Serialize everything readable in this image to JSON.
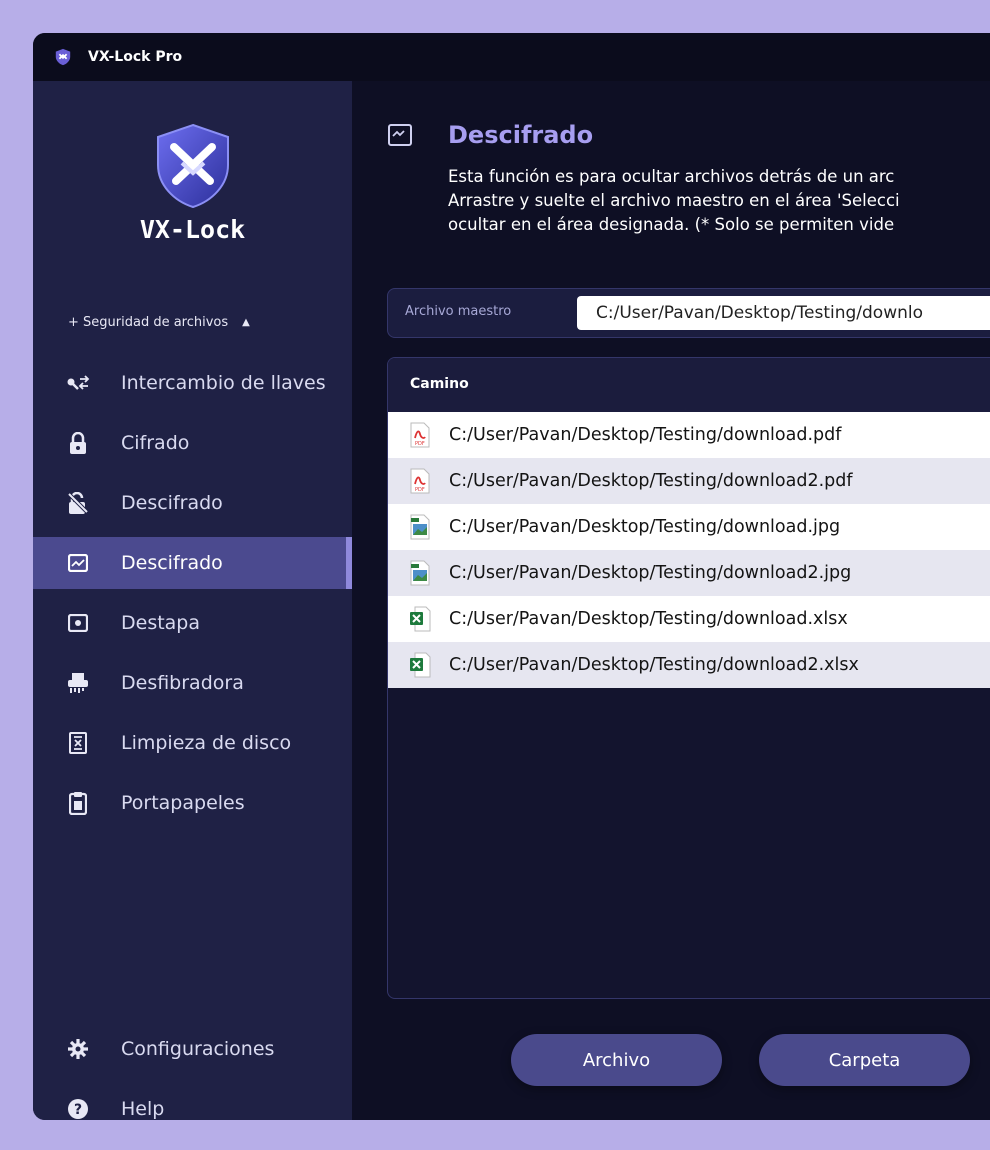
{
  "app": {
    "title": "VX-Lock Pro",
    "logo_text": "VX-Lock"
  },
  "sidebar": {
    "section_label": "+ Seguridad de archivos",
    "items": [
      {
        "label": "Intercambio de llaves",
        "icon": "key-exchange-icon"
      },
      {
        "label": "Cifrado",
        "icon": "lock-icon"
      },
      {
        "label": "Descifrado",
        "icon": "unlock-icon"
      },
      {
        "label": "Descifrado",
        "icon": "image-hide-icon",
        "active": true
      },
      {
        "label": "Destapa",
        "icon": "reveal-icon"
      },
      {
        "label": "Desfibradora",
        "icon": "shredder-icon"
      },
      {
        "label": "Limpieza de disco",
        "icon": "disk-clean-icon"
      },
      {
        "label": "Portapapeles",
        "icon": "clipboard-icon"
      }
    ],
    "bottom": [
      {
        "label": "Configuraciones",
        "icon": "gear-icon"
      },
      {
        "label": "Help",
        "icon": "help-icon"
      }
    ]
  },
  "main": {
    "title": "Descifrado",
    "description": [
      "Esta función es para ocultar archivos detrás de un arc",
      "Arrastre y suelte el archivo maestro en el área 'Selecci",
      "ocultar en el área designada. (* Solo se permiten vide"
    ],
    "master_label": "Archivo maestro",
    "master_value": "C:/User/Pavan/Desktop/Testing/downlo",
    "table_header": "Camino",
    "files": [
      {
        "path": "C:/User/Pavan/Desktop/Testing/download.pdf",
        "type": "pdf"
      },
      {
        "path": "C:/User/Pavan/Desktop/Testing/download2.pdf",
        "type": "pdf"
      },
      {
        "path": "C:/User/Pavan/Desktop/Testing/download.jpg",
        "type": "jpg"
      },
      {
        "path": "C:/User/Pavan/Desktop/Testing/download2.jpg",
        "type": "jpg"
      },
      {
        "path": "C:/User/Pavan/Desktop/Testing/download.xlsx",
        "type": "xlsx"
      },
      {
        "path": "C:/User/Pavan/Desktop/Testing/download2.xlsx",
        "type": "xlsx"
      }
    ],
    "buttons": {
      "file": "Archivo",
      "folder": "Carpeta"
    }
  },
  "colors": {
    "accent": "#a79ef0",
    "active_nav": "#4b4a8f",
    "button": "#4a4a8c"
  }
}
